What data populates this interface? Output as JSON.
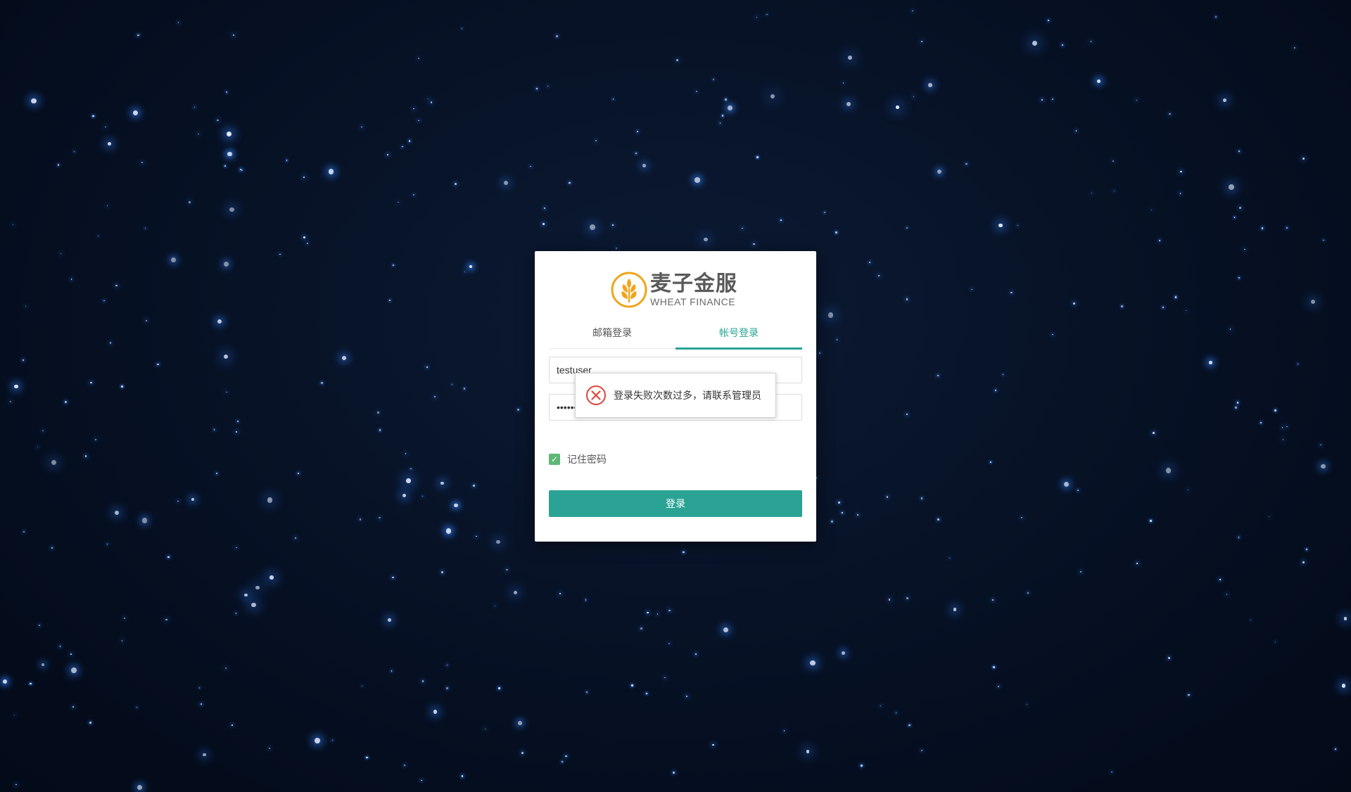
{
  "background": {
    "color": "#060f20",
    "star_color": "#2f7cf0"
  },
  "brand": {
    "name_cn": "麦子金服",
    "name_en": "WHEAT FINANCE",
    "logo_icon": "wheat-logo-icon",
    "logo_color": "#f0a51c"
  },
  "tabs": [
    {
      "label": "邮箱登录",
      "active": false
    },
    {
      "label": "帐号登录",
      "active": true
    }
  ],
  "form": {
    "username_value": "testuser",
    "password_value": "••••••",
    "remember_label": "记住密码",
    "remember_checked": true,
    "login_button": "登录"
  },
  "toast": {
    "icon": "error-x-icon",
    "message": "登录失败次数过多，请联系管理员"
  },
  "accent_color": "#2aa395"
}
